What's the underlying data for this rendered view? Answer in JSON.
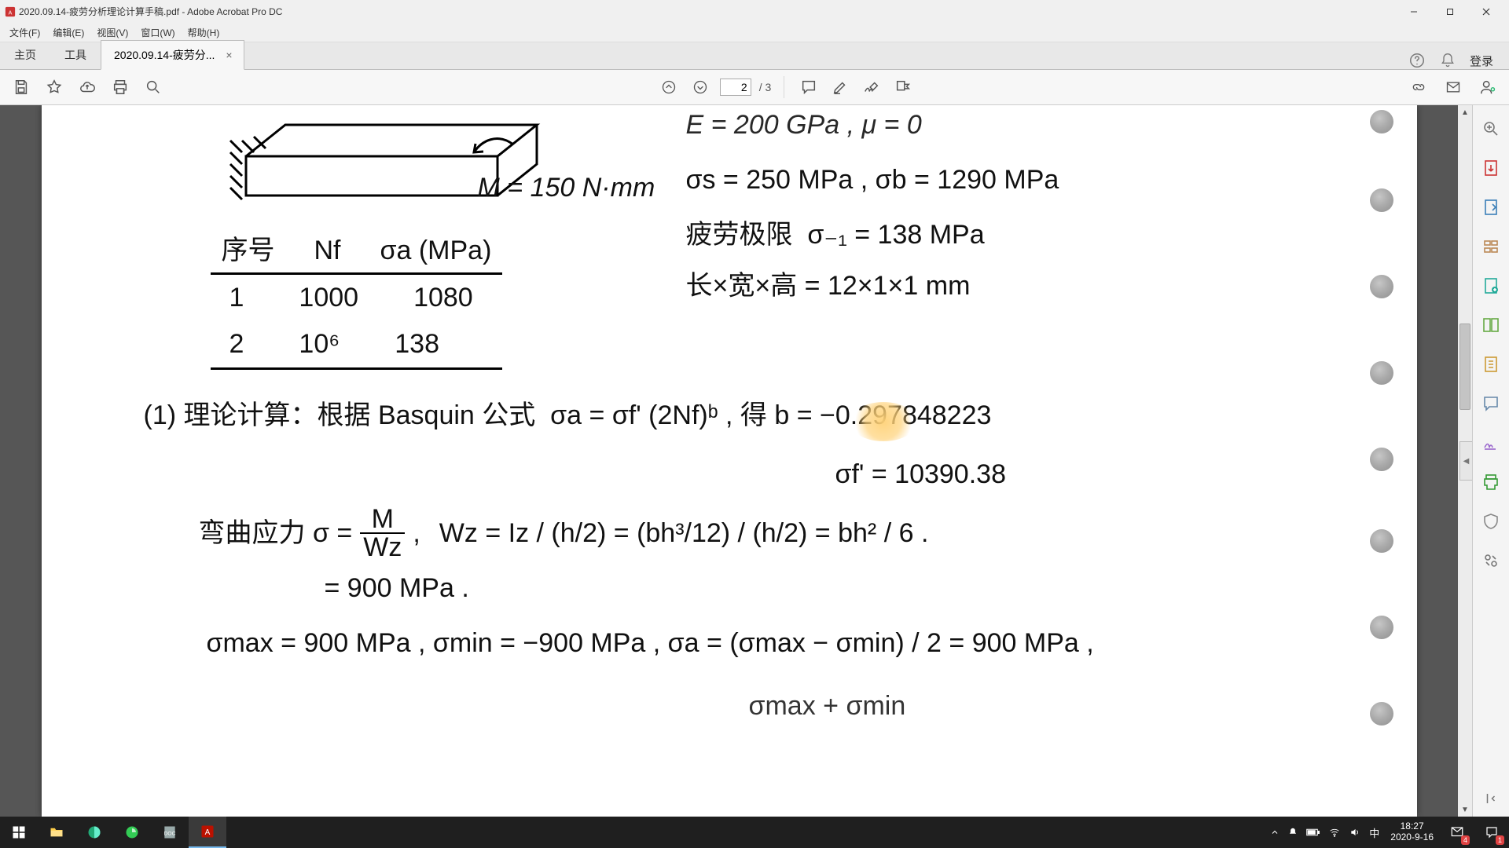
{
  "window": {
    "title": "2020.09.14-疲劳分析理论计算手稿.pdf - Adobe Acrobat Pro DC"
  },
  "menu": {
    "file": "文件(F)",
    "edit": "编辑(E)",
    "view": "视图(V)",
    "window": "窗口(W)",
    "help": "帮助(H)"
  },
  "tabs": {
    "home": "主页",
    "tools": "工具",
    "doc_label": "2020.09.14-疲劳分...",
    "login": "登录"
  },
  "toolbar": {
    "page_current": "2",
    "page_total": "/ 3"
  },
  "doc": {
    "sketch_caption": "M = 150 N·mm",
    "table_header_col1": "序号",
    "table_header_col2": "Nf",
    "table_header_col3": "σa (MPa)",
    "row1_c1": "1",
    "row1_c2": "1000",
    "row1_c3": "1080",
    "row2_c1": "2",
    "row2_c2": "10⁶",
    "row2_c3": "138",
    "right1": "E = 200 GPa , μ = 0",
    "right2": "σs = 250 MPa , σb = 1290 MPa",
    "right3_label": "疲劳极限",
    "right3_eq": "σ₋₁ = 138 MPa",
    "right4": "长×宽×高 = 12×1×1 mm",
    "step1_label": "(1) 理论计算：根据 Basquin 公式",
    "step1_eq": "σa = σf' (2Nf)ᵇ , 得 b = −0.297848223",
    "step1_eq2": "σf' = 10390.38",
    "bend_left": "弯曲应力 σ =",
    "bend_frac": "M / Wz",
    "bend_comma": ",",
    "bend_right": "Wz = Iz / (h/2) = (bh³/12) / (h/2) = bh² / 6 .",
    "bend_result": "= 900 MPa .",
    "sigma_line": "σmax = 900 MPa ,  σmin = −900 MPa ,  σa = (σmax − σmin) / 2 = 900 MPa ,",
    "sigma_tail": "σmax + σmin"
  },
  "tray": {
    "ime": "中",
    "time": "18:27",
    "date": "2020-9-16",
    "badge1": "4",
    "badge2": "1"
  }
}
